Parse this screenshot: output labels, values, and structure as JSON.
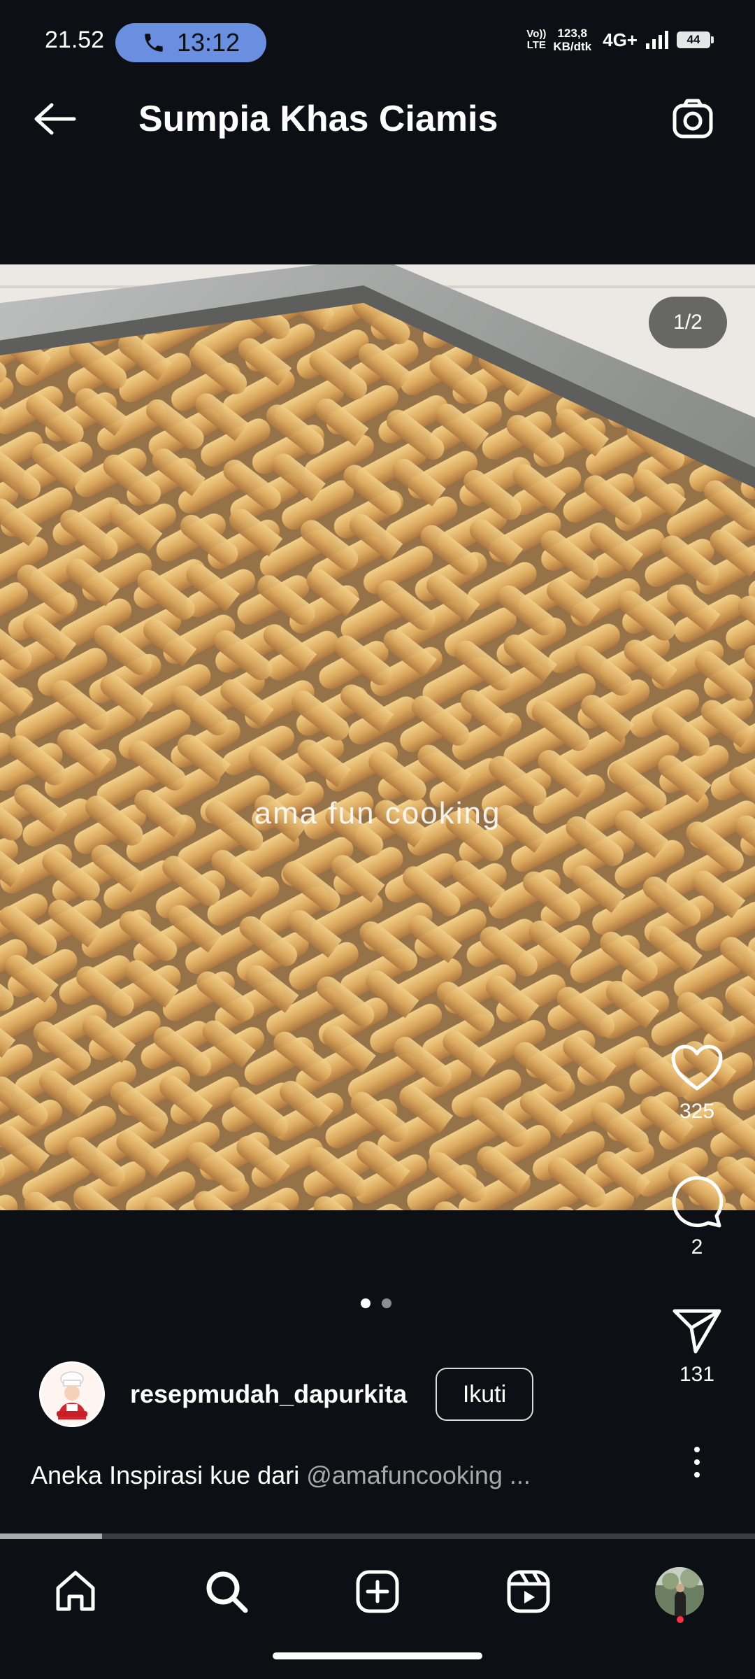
{
  "status_bar": {
    "time": "21.52",
    "call_time": "13:12",
    "volte_top": "Vo))",
    "volte_bottom": "LTE",
    "speed_value": "123,8",
    "speed_unit": "KB/dtk",
    "network": "4G+",
    "battery": "44"
  },
  "header": {
    "title": "Sumpia Khas Ciamis"
  },
  "post": {
    "page_indicator": "1/2",
    "watermark": "ama fun cooking",
    "likes": "325",
    "comments": "2",
    "shares": "131",
    "carousel_pages": 2,
    "carousel_current": 1,
    "progress": 0.135
  },
  "author": {
    "username": "resepmudah_dapurkita",
    "follow_label": "Ikuti"
  },
  "caption": {
    "text": "Aneka Inspirasi kue dari ",
    "mention": "@amafuncooking ..."
  },
  "icons": {
    "back": "arrow-left-icon",
    "camera": "camera-icon",
    "like": "heart-icon",
    "comment": "comment-icon",
    "share": "send-icon",
    "more": "more-vertical-icon",
    "home": "home-icon",
    "search": "search-icon",
    "create": "plus-square-icon",
    "reels": "reels-icon"
  },
  "colors": {
    "background": "#0c1014",
    "call_pill": "#6a8fe0",
    "notification_dot": "#ff3040"
  }
}
